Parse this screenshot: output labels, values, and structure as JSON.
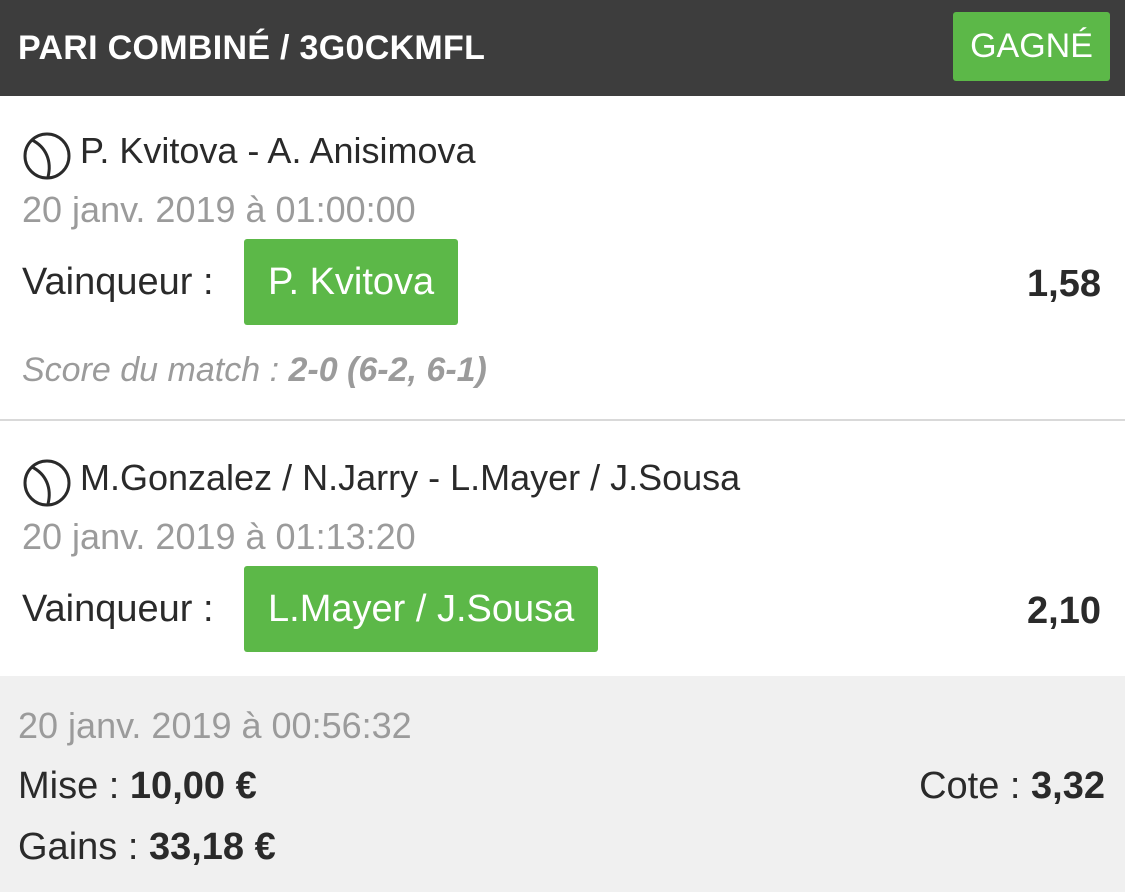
{
  "header": {
    "title": "PARI COMBINÉ / 3G0CKMFL",
    "status": "GAGNÉ",
    "background": "#3d3d3d"
  },
  "colors": {
    "accent_green": "#5cb848",
    "muted_text": "#9b9b9b",
    "summary_bg": "#f0f0f0"
  },
  "bets": [
    {
      "icon": "tennis-ball-icon",
      "match": "P. Kvitova - A. Anisimova",
      "date": "20 janv. 2019 à 01:00:00",
      "winner_label": "Vainqueur :",
      "winner": "P. Kvitova",
      "odds": "1,58",
      "score_label": "Score du match :",
      "score_value": "2-0 (6-2, 6-1)"
    },
    {
      "icon": "tennis-ball-icon",
      "match": "M.Gonzalez / N.Jarry - L.Mayer / J.Sousa",
      "date": "20 janv. 2019 à 01:13:20",
      "winner_label": "Vainqueur :",
      "winner": "L.Mayer / J.Sousa",
      "odds": "2,10"
    }
  ],
  "summary": {
    "date": "20 janv. 2019 à 00:56:32",
    "stake_label": "Mise  :",
    "stake_value": "10,00 €",
    "total_odds_label": "Cote :",
    "total_odds_value": "3,32",
    "gains_label": "Gains :",
    "gains_value": "33,18 €"
  }
}
